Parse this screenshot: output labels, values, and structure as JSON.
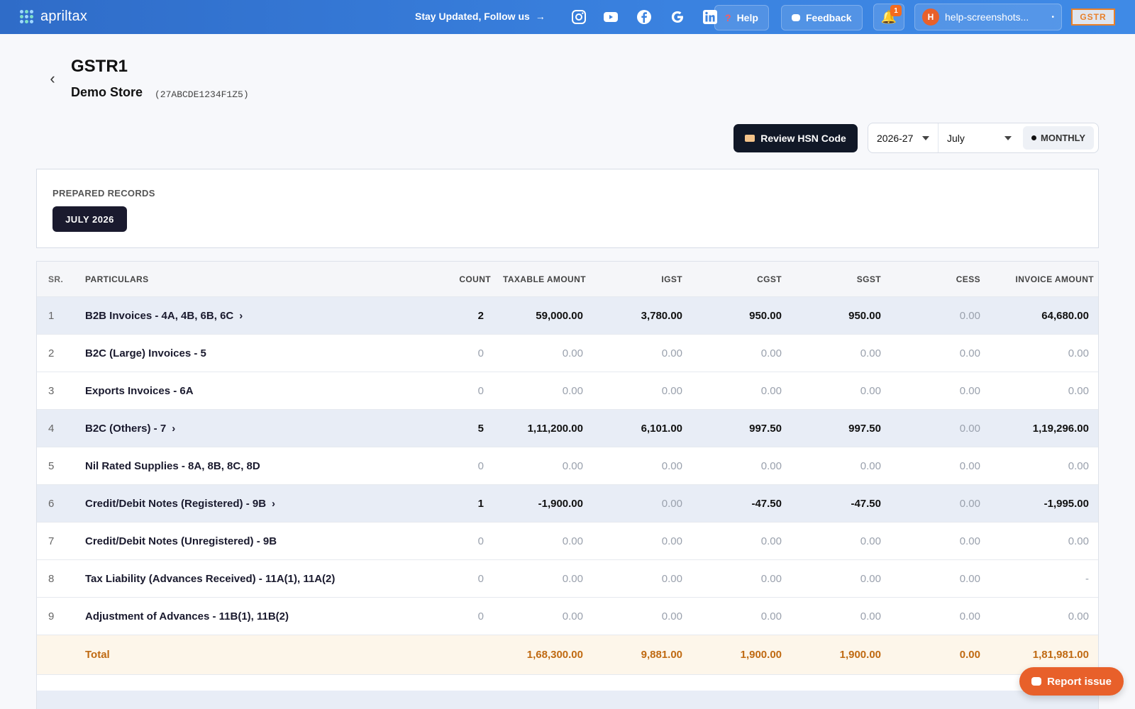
{
  "topbar": {
    "brand": "apriltax",
    "follow_text": "Stay Updated, Follow us",
    "social_icons": [
      "instagram-icon",
      "youtube-icon",
      "facebook-icon",
      "google-icon",
      "linkedin-icon"
    ],
    "help_label": "Help",
    "feedback_label": "Feedback",
    "notification_count": "1",
    "account_initial": "H",
    "account_name": "help-screenshots...",
    "product_tag": "GSTR"
  },
  "header": {
    "title": "GSTR1",
    "store_name": "Demo Store",
    "gstin": "(27ABCDE1234F1Z5)",
    "review_hsn_label": "Review HSN Code",
    "year": "2026-27",
    "month": "July",
    "period_type": "MONTHLY"
  },
  "prepared": {
    "label": "PREPARED RECORDS",
    "chip": "JULY 2026"
  },
  "table": {
    "headers": {
      "sr": "SR.",
      "particulars": "PARTICULARS",
      "count": "COUNT",
      "taxable": "TAXABLE AMOUNT",
      "igst": "IGST",
      "cgst": "CGST",
      "sgst": "SGST",
      "cess": "CESS",
      "invoice": "INVOICE AMOUNT"
    },
    "rows": [
      {
        "sr": "1",
        "particulars": "B2B Invoices - 4A, 4B, 6B, 6C",
        "expandable": true,
        "highlight": true,
        "count": "2",
        "taxable": "59,000.00",
        "igst": "3,780.00",
        "cgst": "950.00",
        "sgst": "950.00",
        "cess": "0.00",
        "invoice": "64,680.00"
      },
      {
        "sr": "2",
        "particulars": "B2C (Large) Invoices - 5",
        "expandable": false,
        "highlight": false,
        "count": "0",
        "taxable": "0.00",
        "igst": "0.00",
        "cgst": "0.00",
        "sgst": "0.00",
        "cess": "0.00",
        "invoice": "0.00"
      },
      {
        "sr": "3",
        "particulars": "Exports Invoices - 6A",
        "expandable": false,
        "highlight": false,
        "count": "0",
        "taxable": "0.00",
        "igst": "0.00",
        "cgst": "0.00",
        "sgst": "0.00",
        "cess": "0.00",
        "invoice": "0.00"
      },
      {
        "sr": "4",
        "particulars": "B2C (Others) - 7",
        "expandable": true,
        "highlight": true,
        "count": "5",
        "taxable": "1,11,200.00",
        "igst": "6,101.00",
        "cgst": "997.50",
        "sgst": "997.50",
        "cess": "0.00",
        "invoice": "1,19,296.00"
      },
      {
        "sr": "5",
        "particulars": "Nil Rated Supplies - 8A, 8B, 8C, 8D",
        "expandable": false,
        "highlight": false,
        "count": "0",
        "taxable": "0.00",
        "igst": "0.00",
        "cgst": "0.00",
        "sgst": "0.00",
        "cess": "0.00",
        "invoice": "0.00"
      },
      {
        "sr": "6",
        "particulars": "Credit/Debit Notes (Registered) - 9B",
        "expandable": true,
        "highlight": true,
        "count": "1",
        "taxable": "-1,900.00",
        "igst": "0.00",
        "cgst": "-47.50",
        "sgst": "-47.50",
        "cess": "0.00",
        "invoice": "-1,995.00"
      },
      {
        "sr": "7",
        "particulars": "Credit/Debit Notes (Unregistered) - 9B",
        "expandable": false,
        "highlight": false,
        "count": "0",
        "taxable": "0.00",
        "igst": "0.00",
        "cgst": "0.00",
        "sgst": "0.00",
        "cess": "0.00",
        "invoice": "0.00"
      },
      {
        "sr": "8",
        "particulars": "Tax Liability (Advances Received) - 11A(1), 11A(2)",
        "expandable": false,
        "highlight": false,
        "count": "0",
        "taxable": "0.00",
        "igst": "0.00",
        "cgst": "0.00",
        "sgst": "0.00",
        "cess": "0.00",
        "invoice": "-"
      },
      {
        "sr": "9",
        "particulars": "Adjustment of Advances - 11B(1), 11B(2)",
        "expandable": false,
        "highlight": false,
        "count": "0",
        "taxable": "0.00",
        "igst": "0.00",
        "cgst": "0.00",
        "sgst": "0.00",
        "cess": "0.00",
        "invoice": "0.00"
      }
    ],
    "total": {
      "label": "Total",
      "taxable": "1,68,300.00",
      "igst": "9,881.00",
      "cgst": "1,900.00",
      "sgst": "1,900.00",
      "cess": "0.00",
      "invoice": "1,81,981.00"
    }
  },
  "report_issue_label": "Report issue",
  "colors": {
    "topbar": "#3a82e0",
    "dark_button": "#111827",
    "total_text": "#c06a12",
    "total_bg": "#fdf6ea",
    "report_button": "#e8602a"
  }
}
